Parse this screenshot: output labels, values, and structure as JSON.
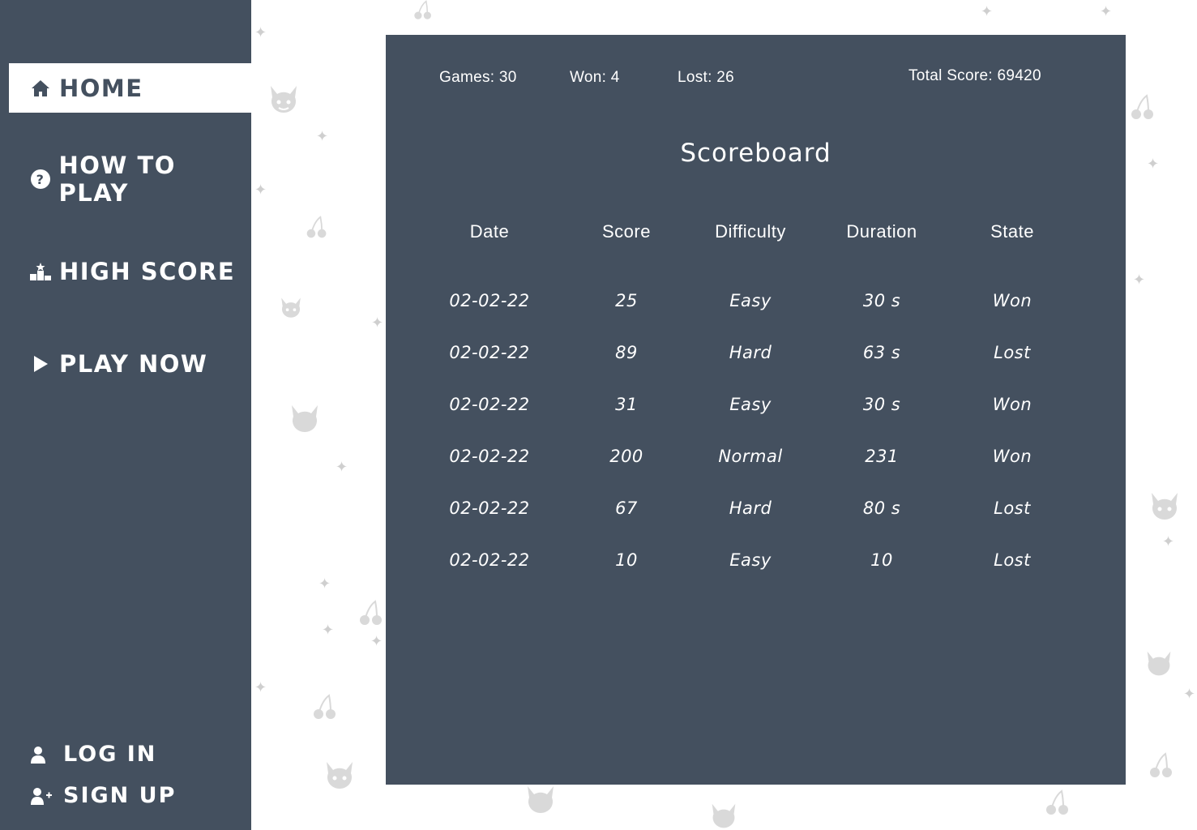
{
  "nav": {
    "home": "HOME",
    "how_to_play": "HOW TO PLAY",
    "high_score": "HIGH SCORE",
    "play_now": "PLAY NOW",
    "log_in": "LOG IN",
    "sign_up": "SIGN UP"
  },
  "stats": {
    "games": "Games: 30",
    "won": "Won: 4",
    "lost": "Lost: 26",
    "total_score": "Total Score: 69420"
  },
  "scoreboard": {
    "title": "Scoreboard",
    "headers": [
      "Date",
      "Score",
      "Difficulty",
      "Duration",
      "State"
    ],
    "rows": [
      [
        "02-02-22",
        "25",
        "Easy",
        "30 s",
        "Won"
      ],
      [
        "02-02-22",
        "89",
        "Hard",
        "63 s",
        "Lost"
      ],
      [
        "02-02-22",
        "31",
        "Easy",
        "30 s",
        "Won"
      ],
      [
        "02-02-22",
        "200",
        "Normal",
        "231",
        "Won"
      ],
      [
        "02-02-22",
        "67",
        "Hard",
        "80 s",
        "Lost"
      ],
      [
        "02-02-22",
        "10",
        "Easy",
        "10",
        "Lost"
      ]
    ]
  },
  "colors": {
    "sidebar_bg": "#44505f",
    "panel_bg": "#44505f",
    "active_nav_bg": "#ffffff",
    "pattern": "#d9d9d9"
  },
  "icons": {
    "home": "home-icon",
    "how_to_play": "question-circle-icon",
    "high_score": "podium-icon",
    "play_now": "play-icon",
    "log_in": "user-icon",
    "sign_up": "user-plus-icon",
    "background": [
      "devil-icon",
      "cherry-icon",
      "sparkle-icon"
    ]
  }
}
